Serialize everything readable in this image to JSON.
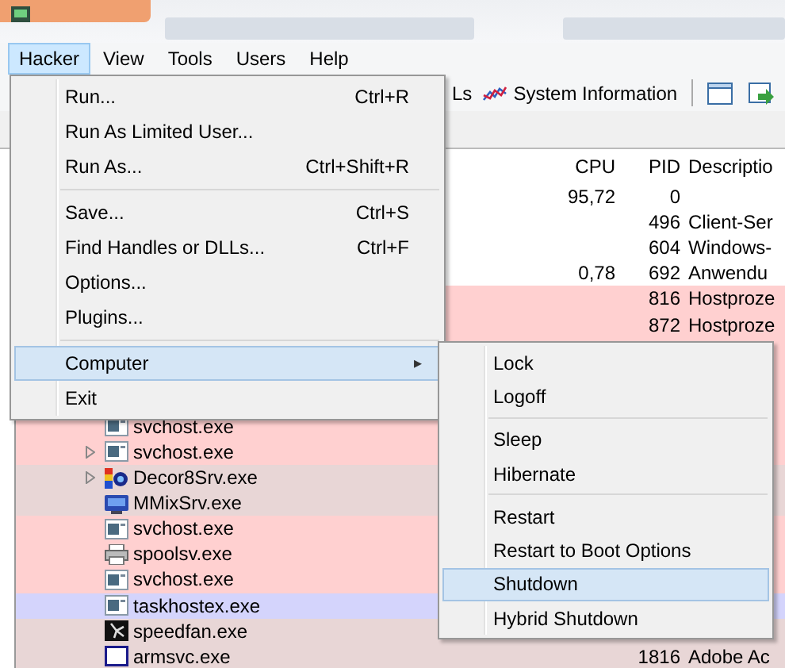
{
  "menubar": [
    {
      "label": "Hacker",
      "selected": true
    },
    {
      "label": "View",
      "selected": false
    },
    {
      "label": "Tools",
      "selected": false
    },
    {
      "label": "Users",
      "selected": false
    },
    {
      "label": "Help",
      "selected": false
    }
  ],
  "toolbar": {
    "partial_button": "Ls",
    "system_information": "System Information"
  },
  "table": {
    "columns": [
      {
        "label": "CPU"
      },
      {
        "label": "PID"
      },
      {
        "label": "Descriptio"
      }
    ],
    "rows": [
      {
        "cpu": "95,72",
        "pid": "0",
        "color": "#ffffff"
      },
      {
        "pid": "496",
        "description": "Client-Ser",
        "color": "#ffffff"
      },
      {
        "pid": "604",
        "description": "Windows-",
        "color": "#ffffff"
      },
      {
        "cpu": "0,78",
        "pid": "692",
        "description": "Anwendu",
        "color": "#ffffff"
      },
      {
        "pid": "816",
        "description": "Hostproze",
        "color": "#ffd0d0"
      },
      {
        "pid": "872",
        "description": "Hostproze",
        "color": "#ffd0d0"
      },
      {
        "color": "#ffd0d0"
      },
      {
        "color": "#ffd0d0"
      },
      {
        "color": "#ffd0d0"
      },
      {
        "name": "svchost.exe",
        "kind": "window",
        "expandable": false,
        "color": "#ffd0d0"
      },
      {
        "name": "svchost.exe",
        "kind": "window",
        "expandable": true,
        "color": "#ffd0d0"
      },
      {
        "name": "Decor8Srv.exe",
        "kind": "colorful",
        "expandable": true,
        "color": "#e8d6d6"
      },
      {
        "name": "MMixSrv.exe",
        "kind": "monitor",
        "expandable": false,
        "color": "#e8d6d6"
      },
      {
        "name": "svchost.exe",
        "kind": "window",
        "expandable": false,
        "color": "#ffd0d0"
      },
      {
        "name": "spoolsv.exe",
        "kind": "printer",
        "expandable": false,
        "color": "#ffd0d0"
      },
      {
        "name": "svchost.exe",
        "kind": "window",
        "expandable": false,
        "color": "#ffd0d0"
      },
      {
        "name": "taskhostex.exe",
        "kind": "window",
        "expandable": false,
        "color": "#d4d4fc"
      },
      {
        "name": "speedfan.exe",
        "kind": "fan",
        "expandable": false,
        "color": "#e8d6d6"
      },
      {
        "name": "armsvc.exe",
        "kind": "frame",
        "expandable": false,
        "pid": "1816",
        "description": "Adobe Ac",
        "color": "#e8d6d6"
      }
    ]
  },
  "menu": [
    {
      "kind": "item",
      "label": "Run...",
      "shortcut": "Ctrl+R",
      "selected": false
    },
    {
      "kind": "item",
      "label": "Run As Limited User...",
      "selected": false
    },
    {
      "kind": "item",
      "label": "Run As...",
      "shortcut": "Ctrl+Shift+R",
      "selected": false
    },
    {
      "kind": "separator"
    },
    {
      "kind": "item",
      "label": "Save...",
      "shortcut": "Ctrl+S",
      "selected": false
    },
    {
      "kind": "item",
      "label": "Find Handles or DLLs...",
      "shortcut": "Ctrl+F",
      "selected": false
    },
    {
      "kind": "item",
      "label": "Options...",
      "selected": false
    },
    {
      "kind": "item",
      "label": "Plugins...",
      "selected": false
    },
    {
      "kind": "separator"
    },
    {
      "kind": "submenu",
      "label": "Computer",
      "arrow": "▸",
      "selected": true
    },
    {
      "kind": "item",
      "label": "Exit",
      "selected": false
    }
  ],
  "submenu": [
    {
      "kind": "item",
      "label": "Lock",
      "selected": false
    },
    {
      "kind": "item",
      "label": "Logoff",
      "selected": false
    },
    {
      "kind": "separator"
    },
    {
      "kind": "item",
      "label": "Sleep",
      "selected": false
    },
    {
      "kind": "item",
      "label": "Hibernate",
      "selected": false
    },
    {
      "kind": "separator"
    },
    {
      "kind": "item",
      "label": "Restart",
      "selected": false
    },
    {
      "kind": "item",
      "label": "Restart to Boot Options",
      "selected": false
    },
    {
      "kind": "item",
      "label": "Shutdown",
      "selected": true
    },
    {
      "kind": "item",
      "label": "Hybrid Shutdown",
      "selected": false
    }
  ]
}
